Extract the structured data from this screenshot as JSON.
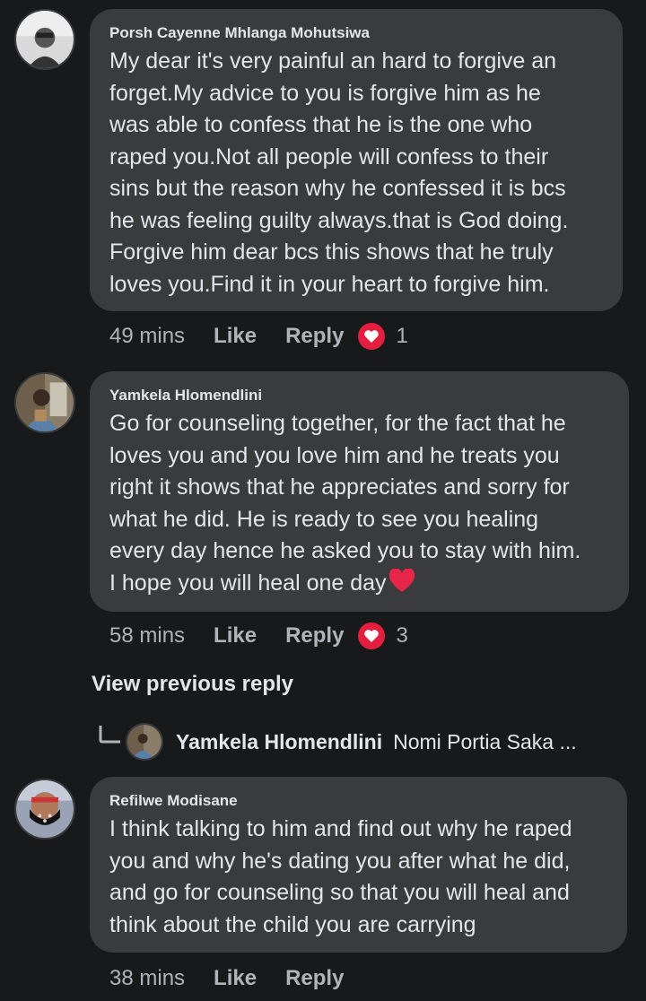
{
  "comments": [
    {
      "author": "Porsh Cayenne Mhlanga Mohutsiwa",
      "text": "My dear it's very painful an hard to forgive an\nforget.My advice to you is forgive him as he\nwas able to confess that he is the one who\nraped you.Not all people will confess to their\nsins but the reason why he confessed it is bcs\nhe was feeling guilty always.that is God doing.\nForgive him dear bcs this shows that he truly\nloves you.Find it in your heart to forgive him.",
      "time": "49 mins",
      "like_label": "Like",
      "reply_label": "Reply",
      "reaction_icon": "heart-icon",
      "reaction_count": "1"
    },
    {
      "author": "Yamkela Hlomendlini",
      "text": "Go for counseling together, for the fact that he\nloves you and you love him and he treats you\nright it shows that he appreciates and sorry for\nwhat he did. He is ready to see you healing\nevery day hence he asked you to stay with him.\nI hope you will heal one day",
      "inline_emoji": "red-heart",
      "time": "58 mins",
      "like_label": "Like",
      "reply_label": "Reply",
      "reaction_icon": "heart-icon",
      "reaction_count": "3"
    },
    {
      "author": "Refilwe Modisane",
      "text": "I think talking to him and find out why he raped\nyou and why he's dating you after what he did,\nand go for counseling so that you will heal and\nthink about the child you are carrying",
      "time": "38 mins",
      "like_label": "Like",
      "reply_label": "Reply"
    }
  ],
  "view_previous_reply": "View previous reply",
  "collapsed_reply": {
    "author": "Yamkela Hlomendlini",
    "preview": "Nomi Portia Saka ..."
  },
  "colors": {
    "background": "#18191a",
    "bubble": "#3a3b3c",
    "text": "#e4e6eb",
    "secondary": "#b0b3b8",
    "heart": "#e41e3f"
  }
}
